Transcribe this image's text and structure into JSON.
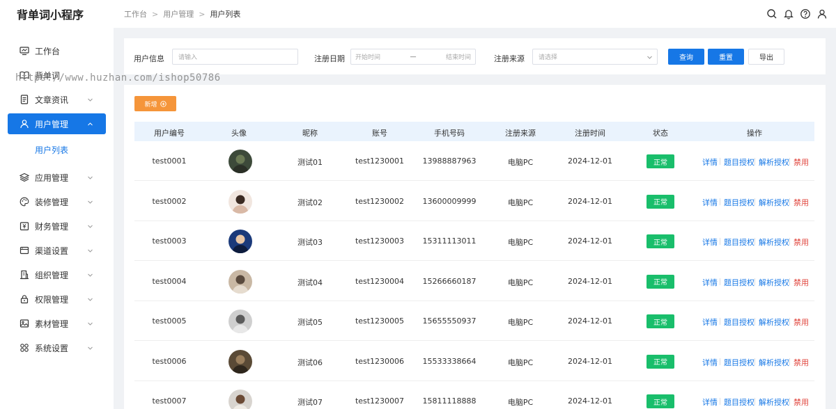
{
  "app": {
    "title": "背单词小程序"
  },
  "breadcrumb": [
    "工作台",
    "用户管理",
    "用户列表"
  ],
  "header_icons": [
    "search-icon",
    "bell-icon",
    "help-icon",
    "user-icon"
  ],
  "sidebar": {
    "items": [
      {
        "label": "工作台",
        "icon": "monitor-icon",
        "expandable": false
      },
      {
        "label": "背单词",
        "icon": "book-icon",
        "expandable": false
      },
      {
        "label": "文章资讯",
        "icon": "document-icon",
        "expandable": true
      },
      {
        "label": "用户管理",
        "icon": "user-icon",
        "expandable": true,
        "active": true
      },
      {
        "label": "应用管理",
        "icon": "layers-icon",
        "expandable": true
      },
      {
        "label": "装修管理",
        "icon": "palette-icon",
        "expandable": true
      },
      {
        "label": "财务管理",
        "icon": "finance-icon",
        "expandable": true
      },
      {
        "label": "渠道设置",
        "icon": "channel-icon",
        "expandable": true
      },
      {
        "label": "组织管理",
        "icon": "building-icon",
        "expandable": true
      },
      {
        "label": "权限管理",
        "icon": "lock-icon",
        "expandable": true
      },
      {
        "label": "素材管理",
        "icon": "image-icon",
        "expandable": true
      },
      {
        "label": "系统设置",
        "icon": "grid-icon",
        "expandable": true
      }
    ],
    "submenu": {
      "label": "用户列表"
    }
  },
  "watermark": "https://www.huzhan.com/ishop50786",
  "filters": {
    "user_info_label": "用户信息",
    "user_info_placeholder": "请输入",
    "reg_date_label": "注册日期",
    "start_placeholder": "开始时间",
    "range_sep": "—",
    "end_placeholder": "结束时间",
    "source_label": "注册来源",
    "source_placeholder": "请选择",
    "query_label": "查询",
    "reset_label": "重置",
    "export_label": "导出"
  },
  "add_button": "新增",
  "colors": {
    "primary": "#1677e6",
    "success": "#19be6b",
    "warning": "#f5953a",
    "danger": "#e0433b"
  },
  "table": {
    "columns": [
      "用户编号",
      "头像",
      "昵称",
      "账号",
      "手机号码",
      "注册来源",
      "注册时间",
      "状态",
      "操作"
    ],
    "rows": [
      {
        "id": "test0001",
        "nickname": "测试01",
        "account": "test1230001",
        "phone": "13988887963",
        "source": "电脑PC",
        "date": "2024-12-01",
        "status": "正常"
      },
      {
        "id": "test0002",
        "nickname": "测试02",
        "account": "test1230002",
        "phone": "13600009999",
        "source": "电脑PC",
        "date": "2024-12-01",
        "status": "正常"
      },
      {
        "id": "test0003",
        "nickname": "测试03",
        "account": "test1230003",
        "phone": "15311113011",
        "source": "电脑PC",
        "date": "2024-12-01",
        "status": "正常"
      },
      {
        "id": "test0004",
        "nickname": "测试04",
        "account": "test1230004",
        "phone": "15266660187",
        "source": "电脑PC",
        "date": "2024-12-01",
        "status": "正常"
      },
      {
        "id": "test0005",
        "nickname": "测试05",
        "account": "test1230005",
        "phone": "15655550937",
        "source": "电脑PC",
        "date": "2024-12-01",
        "status": "正常"
      },
      {
        "id": "test0006",
        "nickname": "测试06",
        "account": "test1230006",
        "phone": "15533338664",
        "source": "电脑PC",
        "date": "2024-12-01",
        "status": "正常"
      },
      {
        "id": "test0007",
        "nickname": "测试07",
        "account": "test1230007",
        "phone": "15811118888",
        "source": "电脑PC",
        "date": "2024-12-01",
        "status": "正常"
      }
    ],
    "actions": [
      "详情",
      "题目授权",
      "解析授权",
      "禁用"
    ]
  }
}
